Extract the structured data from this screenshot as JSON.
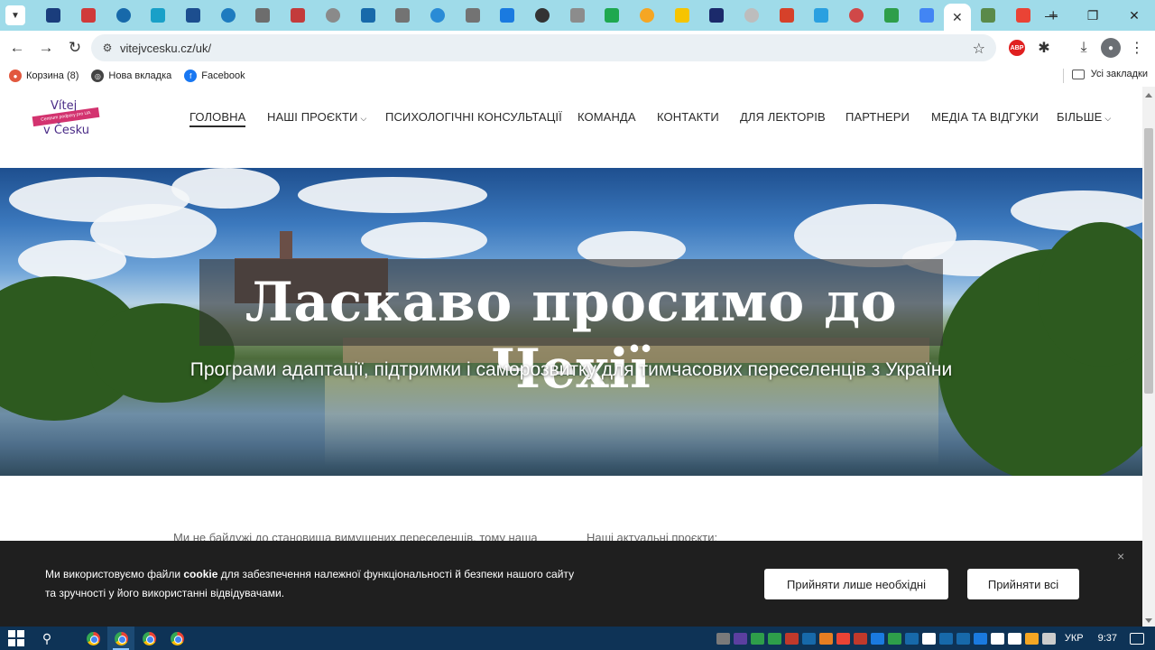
{
  "browser": {
    "tab_favicon_colors": [
      "#1a3d7c",
      "#d03a3a",
      "#1769aa",
      "#19a0c8",
      "#1c4e8f",
      "#1e7bbf",
      "#6d6d6d",
      "#c33b3b",
      "#8a8a8a",
      "#1769aa",
      "#737373",
      "#2a8bd6",
      "#737373",
      "#1a7ae0",
      "#333333",
      "#8c8c8c",
      "#1ea84f",
      "#f5a623",
      "#f6c400",
      "#1b2a6b",
      "#bdbdbd",
      "#d6412a",
      "#2aa0e0",
      "#d04848",
      "#2e9e4a",
      "#4285f4",
      "#5a8a4a",
      "#ea4335"
    ],
    "active_tab_close": "✕",
    "new_tab": "+",
    "url": "vitejvcesku.cz/uk/"
  },
  "bookmarks": {
    "items": [
      {
        "label": "Корзина (8)",
        "icon": "cart-icon",
        "color": "#e2583e"
      },
      {
        "label": "Нова вкладка",
        "icon": "globe-icon",
        "color": "#444444"
      },
      {
        "label": "Facebook",
        "icon": "facebook-icon",
        "color": "#1877f2"
      }
    ],
    "all_label": "Усі закладки"
  },
  "site": {
    "logo": {
      "top": "Vítej",
      "ribbon": "Centrum podpory pro UA",
      "bottom": "v Česku"
    },
    "nav": [
      {
        "label": "ГОЛОВНА",
        "active": true,
        "dropdown": false
      },
      {
        "label": "НАШІ ПРОЄКТИ",
        "active": false,
        "dropdown": true
      },
      {
        "label": "ПСИХОЛОГІЧНІ КОНСУЛЬТАЦІЇ",
        "active": false,
        "dropdown": false
      },
      {
        "label": "КОМАНДА",
        "active": false,
        "dropdown": false
      },
      {
        "label": "КОНТАКТИ",
        "active": false,
        "dropdown": false
      },
      {
        "label": "ДЛЯ ЛЕКТОРІВ",
        "active": false,
        "dropdown": false
      },
      {
        "label": "ПАРТНЕРИ",
        "active": false,
        "dropdown": false
      },
      {
        "label": "МЕДІА ТА ВІДГУКИ",
        "active": false,
        "dropdown": false
      },
      {
        "label": "БІЛЬШЕ",
        "active": false,
        "dropdown": true
      }
    ],
    "hero": {
      "title": "Ласкаво просимо до Чехії",
      "subtitle": "Програми адаптації, підтримки і саморозвитку для тимчасових переселенців з України"
    },
    "intro_left": "Ми не байдужі до становища вимушених переселенців, тому наша",
    "intro_right": "Наші актуальні проєкти:"
  },
  "cookie": {
    "text_before": "Ми використовуємо файли ",
    "text_bold": "cookie",
    "text_after": " для забезпечення належної функціональності й безпеки нашого сайту та зручності у його використанні відвідувачами.",
    "btn_necessary": "Прийняти лише необхідні",
    "btn_all": "Прийняти всі",
    "close": "×"
  },
  "taskbar": {
    "tray_colors": [
      "#7a7a7a",
      "#5b3fa0",
      "#2e9e4a",
      "#2e9e4a",
      "#c0392b",
      "#1769aa",
      "#e67e22",
      "#ea4335",
      "#c0392b",
      "#1a7ae0",
      "#2e9e4a",
      "#1769aa",
      "#ffffff",
      "#1769aa",
      "#1769aa",
      "#1a7ae0",
      "#ffffff",
      "#ffffff",
      "#f5a623",
      "#cccccc"
    ],
    "language": "УКР",
    "time": "9:37"
  }
}
